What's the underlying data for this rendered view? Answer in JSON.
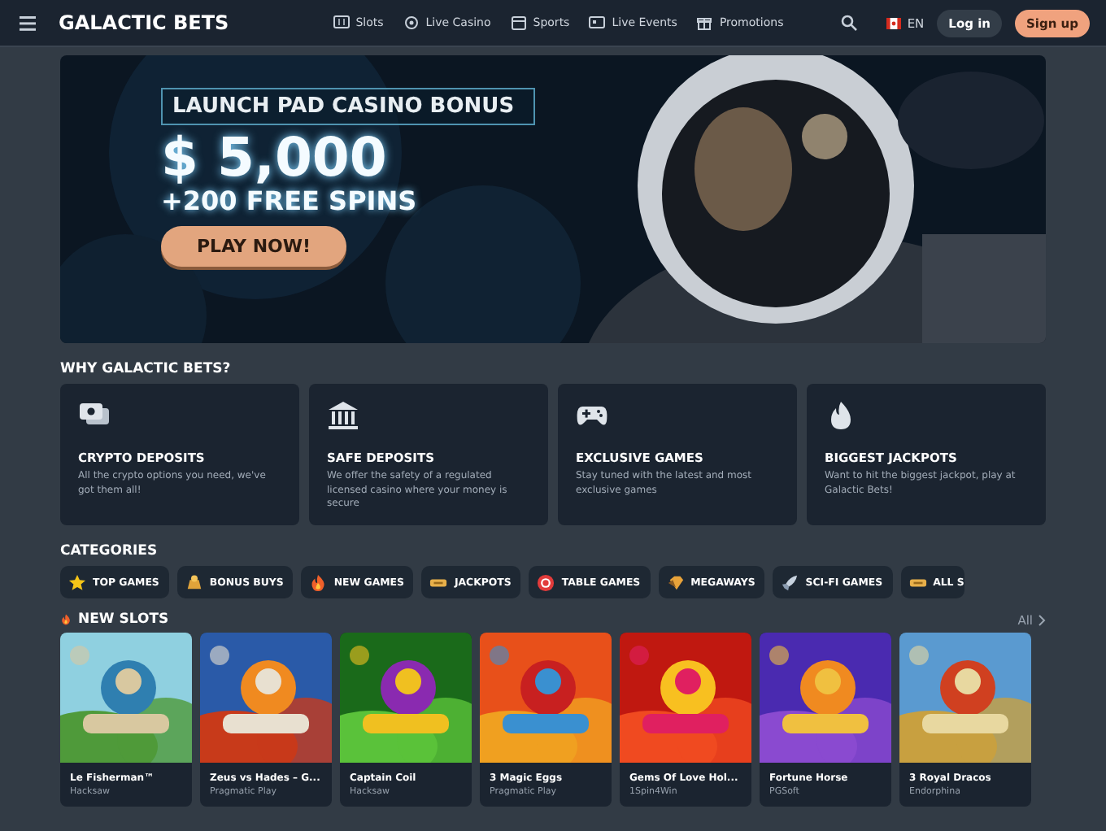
{
  "header": {
    "logo": "GALACTIC BETS",
    "nav": [
      {
        "label": "Slots"
      },
      {
        "label": "Live Casino"
      },
      {
        "label": "Sports"
      },
      {
        "label": "Live Events"
      },
      {
        "label": "Promotions"
      }
    ],
    "language": "EN",
    "login": "Log in",
    "signup": "Sign up"
  },
  "hero": {
    "kind": "picture",
    "eyebrow": "LAUNCH PAD CASINO BONUS",
    "amount": "$ 5,000",
    "subtitle": "+200 FREE SPINS",
    "cta": "PLAY NOW!"
  },
  "why": {
    "title": "WHY GALACTIC BETS?",
    "cards": [
      {
        "title": "CRYPTO DEPOSITS",
        "text": "All the crypto options you need, we've got them all!"
      },
      {
        "title": "SAFE DEPOSITS",
        "text": "We offer the safety of a regulated licensed casino where your money is secure"
      },
      {
        "title": "EXCLUSIVE GAMES",
        "text": "Stay tuned with the latest and most exclusive games"
      },
      {
        "title": "BIGGEST JACKPOTS",
        "text": "Want to hit the biggest jackpot, play at Galactic Bets!"
      }
    ]
  },
  "categories": {
    "title": "CATEGORIES",
    "items": [
      {
        "label": "TOP GAMES"
      },
      {
        "label": "BONUS BUYS"
      },
      {
        "label": "NEW GAMES"
      },
      {
        "label": "JACKPOTS"
      },
      {
        "label": "TABLE GAMES"
      },
      {
        "label": "MEGAWAYS"
      },
      {
        "label": "SCI-FI GAMES"
      },
      {
        "label": "ALL S"
      }
    ]
  },
  "new_slots": {
    "title": "NEW SLOTS",
    "all_link": "All",
    "games": [
      {
        "kind": "picture",
        "name": "Le Fisherman™",
        "provider": "Hacksaw"
      },
      {
        "kind": "picture",
        "name": "Zeus vs Hades – G...",
        "provider": "Pragmatic Play"
      },
      {
        "kind": "picture",
        "name": "Captain Coil",
        "provider": "Hacksaw"
      },
      {
        "kind": "picture",
        "name": "3 Magic Eggs",
        "provider": "Pragmatic Play"
      },
      {
        "kind": "picture",
        "name": "Gems Of Love Hol...",
        "provider": "1Spin4Win"
      },
      {
        "kind": "picture",
        "name": "Fortune Horse",
        "provider": "PGSoft"
      },
      {
        "kind": "picture",
        "name": "3 Royal Dracos",
        "provider": "Endorphina"
      }
    ]
  }
}
